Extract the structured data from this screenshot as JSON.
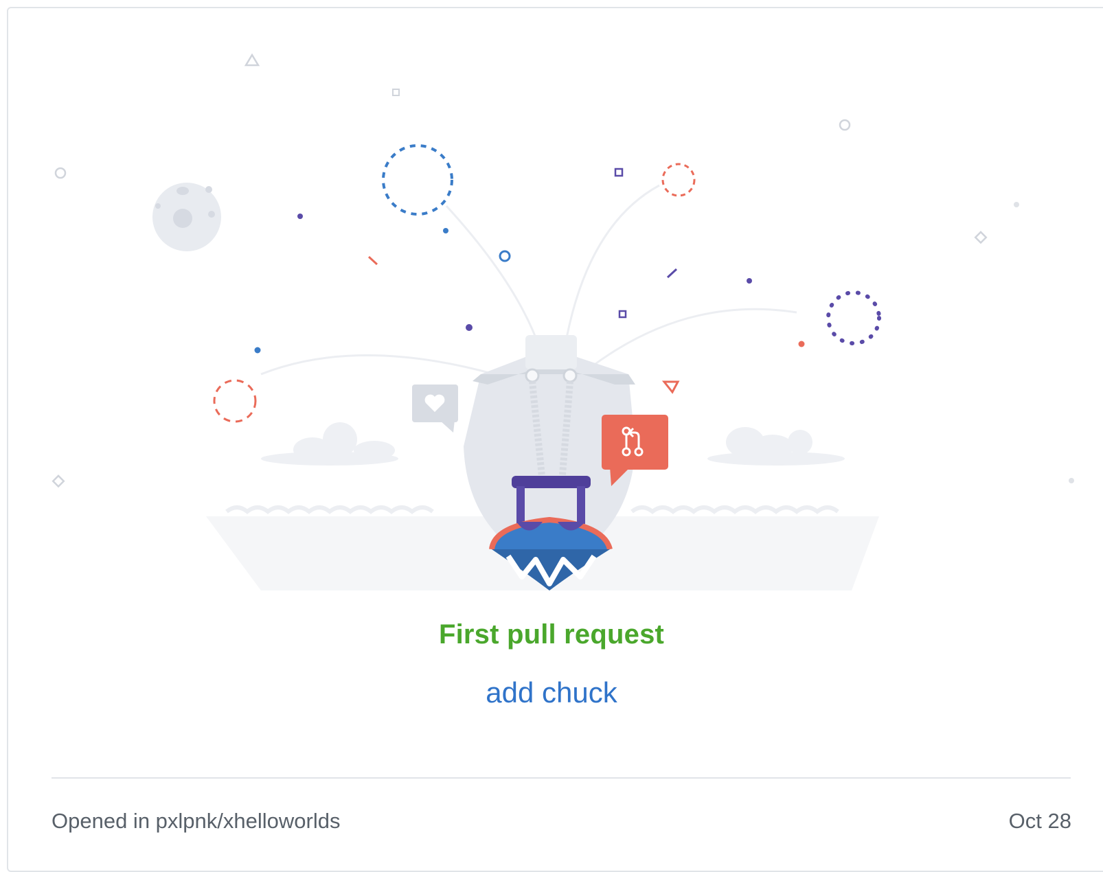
{
  "achievement": {
    "title": "First pull request",
    "pull_request_title": "add chuck",
    "footer": {
      "opened_in": "Opened in pxlpnk/xhelloworlds",
      "date": "Oct 28"
    }
  },
  "colors": {
    "title": "#4aa72c",
    "link": "#2f73c9",
    "muted_text": "#586069",
    "divider": "#e1e4e8",
    "accent_red": "#ea6b59",
    "accent_blue": "#3a7cc8",
    "accent_purple": "#5a4ba8"
  },
  "icons": {
    "moon": "moon-icon",
    "heart_bubble": "heart-speech-bubble-icon",
    "pull_request_bubble": "git-pull-request-icon",
    "ship": "ship-icon"
  }
}
